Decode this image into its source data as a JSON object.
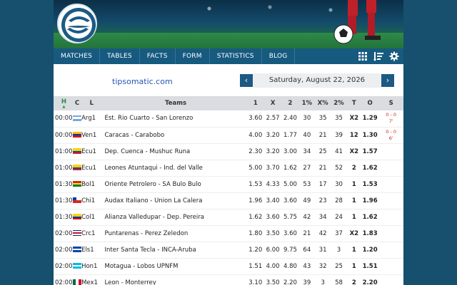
{
  "nav": {
    "items": [
      "MATCHES",
      "TABLES",
      "FACTS",
      "FORM",
      "STATISTICS",
      "BLOG"
    ],
    "icons": [
      "grid-icon",
      "sort-list-icon",
      "gear-icon"
    ]
  },
  "site": "tipsomatic.com",
  "date": {
    "prev": "‹",
    "label": "Saturday, August 22, 2026",
    "next": "›"
  },
  "table": {
    "headers": {
      "h": "H",
      "c": "C",
      "l": "L",
      "teams": "Teams",
      "one": "1",
      "x": "X",
      "two": "2",
      "p1": "1%",
      "px": "X%",
      "p2": "2%",
      "t": "T",
      "o": "O",
      "s": "S"
    },
    "rows": [
      {
        "time": "00:00",
        "flag": "argentina",
        "league": "Arg1",
        "teams": "Est. Rio Cuarto - San Lorenzo",
        "one": "3.60",
        "x": "2.57",
        "two": "2.40",
        "p1": "30",
        "px": "35",
        "p2": "35",
        "t": "X2",
        "o": "1.29",
        "s1": "0 - 0",
        "s2": "7'"
      },
      {
        "time": "00:00",
        "flag": "venezuela",
        "league": "Ven1",
        "teams": "Caracas - Carabobo",
        "one": "4.00",
        "x": "3.20",
        "two": "1.77",
        "p1": "40",
        "px": "21",
        "p2": "39",
        "t": "12",
        "o": "1.30",
        "s1": "0 - 0",
        "s2": "6'"
      },
      {
        "time": "01:00",
        "flag": "ecuador",
        "league": "Ecu1",
        "teams": "Dep. Cuenca - Mushuc Runa",
        "one": "2.30",
        "x": "3.20",
        "two": "3.00",
        "p1": "34",
        "px": "25",
        "p2": "41",
        "t": "X2",
        "o": "1.57",
        "s1": "",
        "s2": ""
      },
      {
        "time": "01:00",
        "flag": "ecuador",
        "league": "Ecu1",
        "teams": "Leones Atuntaqui - Ind. del Valle",
        "one": "5.00",
        "x": "3.70",
        "two": "1.62",
        "p1": "27",
        "px": "21",
        "p2": "52",
        "t": "2",
        "o": "1.62",
        "s1": "",
        "s2": ""
      },
      {
        "time": "01:30",
        "flag": "bolivia",
        "league": "Bol1",
        "teams": "Oriente Petrolero - SA Bulo Bulo",
        "one": "1.53",
        "x": "4.33",
        "two": "5.00",
        "p1": "53",
        "px": "17",
        "p2": "30",
        "t": "1",
        "o": "1.53",
        "s1": "",
        "s2": ""
      },
      {
        "time": "01:30",
        "flag": "chile",
        "league": "Chi1",
        "teams": "Audax Italiano - Union La Calera",
        "one": "1.96",
        "x": "3.40",
        "two": "3.60",
        "p1": "49",
        "px": "23",
        "p2": "28",
        "t": "1",
        "o": "1.96",
        "s1": "",
        "s2": ""
      },
      {
        "time": "01:30",
        "flag": "colombia",
        "league": "Col1",
        "teams": "Alianza Valledupar - Dep. Pereira",
        "one": "1.62",
        "x": "3.60",
        "two": "5.75",
        "p1": "42",
        "px": "34",
        "p2": "24",
        "t": "1",
        "o": "1.62",
        "s1": "",
        "s2": ""
      },
      {
        "time": "02:00",
        "flag": "costarica",
        "league": "Crc1",
        "teams": "Puntarenas - Perez Zeledon",
        "one": "1.80",
        "x": "3.50",
        "two": "3.60",
        "p1": "21",
        "px": "42",
        "p2": "37",
        "t": "X2",
        "o": "1.83",
        "s1": "",
        "s2": ""
      },
      {
        "time": "02:00",
        "flag": "elsalvador",
        "league": "Els1",
        "teams": "Inter Santa Tecla - INCA-Aruba",
        "one": "1.20",
        "x": "6.00",
        "two": "9.75",
        "p1": "64",
        "px": "31",
        "p2": "3",
        "t": "1",
        "o": "1.20",
        "s1": "",
        "s2": ""
      },
      {
        "time": "02:00",
        "flag": "honduras",
        "league": "Hon1",
        "teams": "Motagua - Lobos UPNFM",
        "one": "1.51",
        "x": "4.00",
        "two": "4.80",
        "p1": "43",
        "px": "32",
        "p2": "25",
        "t": "1",
        "o": "1.51",
        "s1": "",
        "s2": ""
      },
      {
        "time": "02:00",
        "flag": "mexico",
        "league": "Mex1",
        "teams": "Leon - Monterrey",
        "one": "3.10",
        "x": "3.50",
        "two": "2.20",
        "p1": "39",
        "px": "3",
        "p2": "58",
        "t": "2",
        "o": "2.20",
        "s1": "",
        "s2": ""
      }
    ]
  },
  "colors": {
    "background": "#16506e",
    "nav": "#175a80",
    "header_row": "#d9dde1",
    "link": "#2a56b6",
    "live_score": "#d02020",
    "h_column": "#2f8a3a"
  }
}
